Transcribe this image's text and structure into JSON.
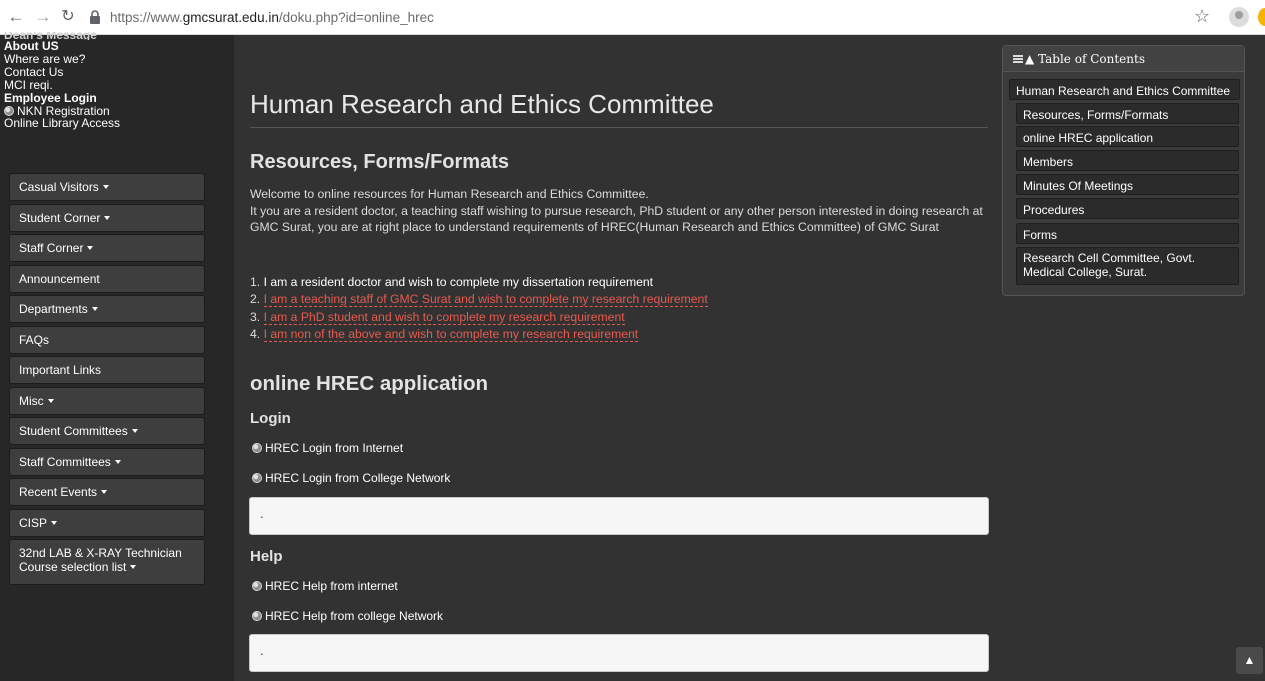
{
  "browser": {
    "url_prefix": "https://www.",
    "url_domain": "gmcsurat.edu.in",
    "url_path": "/doku.php?id=online_hrec"
  },
  "sidebar": {
    "links": [
      {
        "label": "Dean's Message",
        "style": "cut"
      },
      {
        "label": "About US",
        "style": "bold"
      },
      {
        "label": "Where are we?",
        "style": "normal"
      },
      {
        "label": "Contact Us",
        "style": "normal"
      },
      {
        "label": "MCI reqi.",
        "style": "normal"
      },
      {
        "label": "Employee Login",
        "style": "bold"
      },
      {
        "label": "NKN Registration",
        "style": "globe"
      },
      {
        "label": "Online Library Access",
        "style": "normal"
      }
    ],
    "menu": [
      {
        "label": "Casual Visitors",
        "dropdown": true
      },
      {
        "label": "Student Corner",
        "dropdown": true
      },
      {
        "label": "Staff Corner",
        "dropdown": true
      },
      {
        "label": "Announcement",
        "dropdown": false
      },
      {
        "label": "Departments",
        "dropdown": true
      },
      {
        "label": "FAQs",
        "dropdown": false
      },
      {
        "label": "Important Links",
        "dropdown": false
      },
      {
        "label": "Misc",
        "dropdown": true
      },
      {
        "label": "Student Committees",
        "dropdown": true
      },
      {
        "label": "Staff Committees",
        "dropdown": true
      },
      {
        "label": "Recent Events",
        "dropdown": true
      },
      {
        "label": "CISP",
        "dropdown": true
      },
      {
        "label": "32nd LAB & X-RAY Technician Course selection list",
        "dropdown": true
      }
    ]
  },
  "main": {
    "title": "Human Research and Ethics Committee",
    "section1_title": "Resources, Forms/Formats",
    "intro_line1": "Welcome to online resources for Human Research and Ethics Committee.",
    "intro_line2": "It you are a resident doctor, a teaching staff wishing to pursue research, PhD student or any other person interested in doing research at GMC Surat, you are at right place to understand requirements of HREC(Human Research and Ethics Committee) of GMC Surat",
    "options": [
      {
        "num": "1.",
        "text": "I am a resident doctor and wish to complete my dissertation requirement",
        "link": false
      },
      {
        "num": "2.",
        "text": "I am a teaching staff of GMC Surat and wish to complete my research requirement",
        "link": true
      },
      {
        "num": "3.",
        "text": "I am a PhD student and wish to complete my research requirement",
        "link": true
      },
      {
        "num": "4.",
        "text": "I am non of the above and wish to complete my research requirement",
        "link": true
      }
    ],
    "section2_title": "online HREC application",
    "login_title": "Login",
    "login_internet": "HREC Login from Internet",
    "login_college": "HREC Login from College Network",
    "login_box_value": ".",
    "help_title": "Help",
    "help_internet": "HREC Help from internet",
    "help_college": "HREC Help from college Network",
    "help_box_value": "."
  },
  "toc": {
    "header": "Table of Contents",
    "items": [
      {
        "label": "Human Research and Ethics Committee",
        "level": 1
      },
      {
        "label": "Resources, Forms/Formats",
        "level": 2
      },
      {
        "label": "online HREC application",
        "level": 2
      },
      {
        "label": "Members",
        "level": 2
      },
      {
        "label": "Minutes Of Meetings",
        "level": 2
      },
      {
        "label": "Procedures",
        "level": 2
      },
      {
        "label": "Forms",
        "level": 2
      },
      {
        "label": "Research Cell Committee, Govt. Medical College, Surat.",
        "level": 2
      }
    ]
  }
}
